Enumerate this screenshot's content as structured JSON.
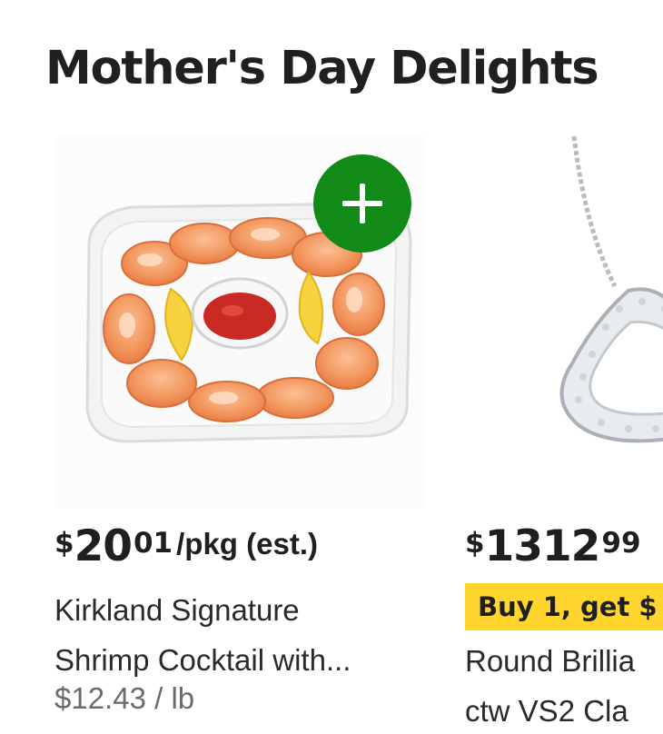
{
  "section": {
    "title": "Mother's Day Delights"
  },
  "products": [
    {
      "price_currency": "$",
      "price_dollars": "20",
      "price_cents": "01",
      "price_unit": "/pkg (est.)",
      "title_line1": "Kirkland Signature",
      "title_line2": "Shrimp Cocktail with...",
      "unit_price": "$12.43 / lb",
      "image": "shrimp-cocktail-platter",
      "add_icon": "plus-icon"
    },
    {
      "price_currency": "$",
      "price_dollars": "1312",
      "price_cents": "99",
      "promo": "Buy 1, get $",
      "title_line1": "Round Brillia",
      "title_line2": "ctw VS2 Cla",
      "image": "diamond-heart-necklace"
    }
  ],
  "colors": {
    "add_button": "#128a17",
    "promo_badge": "#ffd52e",
    "text": "#1f1f1f",
    "muted": "#6b6b6b"
  }
}
